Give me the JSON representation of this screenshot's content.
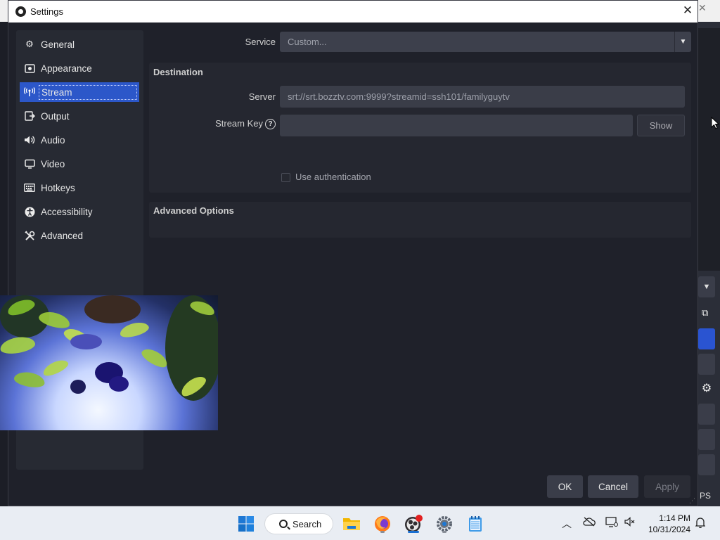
{
  "window": {
    "title": "Settings"
  },
  "sidebar": {
    "items": [
      {
        "label": "General",
        "icon": "gear-icon"
      },
      {
        "label": "Appearance",
        "icon": "appearance-icon"
      },
      {
        "label": "Stream",
        "icon": "antenna-icon",
        "active": true
      },
      {
        "label": "Output",
        "icon": "output-icon"
      },
      {
        "label": "Audio",
        "icon": "speaker-icon"
      },
      {
        "label": "Video",
        "icon": "monitor-icon"
      },
      {
        "label": "Hotkeys",
        "icon": "keyboard-icon"
      },
      {
        "label": "Accessibility",
        "icon": "accessibility-icon"
      },
      {
        "label": "Advanced",
        "icon": "tools-icon"
      }
    ]
  },
  "stream": {
    "service_label": "Service",
    "service_value": "Custom...",
    "destination_title": "Destination",
    "server_label": "Server",
    "server_value": "srt://srt.bozztv.com:9999?streamid=ssh101/familyguytv",
    "stream_key_label": "Stream Key",
    "stream_key_value": "",
    "show_label": "Show",
    "use_auth_label": "Use authentication",
    "use_auth_checked": false,
    "advanced_title": "Advanced Options"
  },
  "footer": {
    "ok": "OK",
    "cancel": "Cancel",
    "apply": "Apply"
  },
  "background": {
    "status_text": "PS"
  },
  "taskbar": {
    "search_label": "Search",
    "time": "1:14 PM",
    "date": "10/31/2024"
  },
  "colors": {
    "accent": "#2c57c9",
    "dialog_bg": "#1f212a",
    "field_bg": "#3a3d48"
  }
}
